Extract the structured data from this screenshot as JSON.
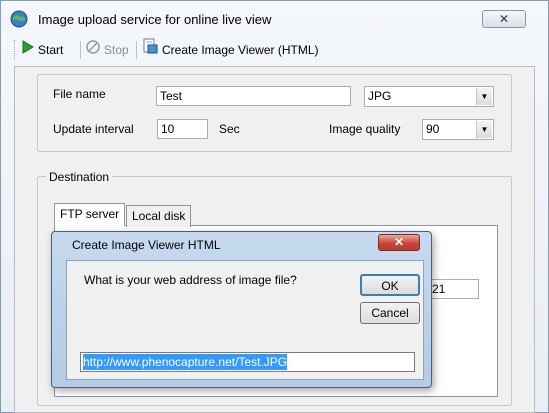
{
  "window": {
    "title": "Image upload service for online live view",
    "close_glyph": "✕"
  },
  "toolbar": {
    "start_label": "Start",
    "stop_label": "Stop",
    "create_viewer_label": "Create Image Viewer (HTML)"
  },
  "settings": {
    "file_name_label": "File name",
    "file_name_value": "Test",
    "format_value": "JPG",
    "update_interval_label": "Update interval",
    "update_interval_value": "10",
    "update_interval_unit": "Sec",
    "image_quality_label": "Image quality",
    "image_quality_value": "90"
  },
  "destination": {
    "legend": "Destination",
    "tabs": [
      {
        "label": "FTP server"
      },
      {
        "label": "Local disk"
      }
    ],
    "partial_field_value": "21"
  },
  "dialog": {
    "title": "Create Image Viewer HTML",
    "close_glyph": "✕",
    "prompt": "What is your web address of image file?",
    "ok_label": "OK",
    "cancel_label": "Cancel",
    "url_value": "http://www.phenocapture.net/Test.JPG"
  },
  "colors": {
    "accent": "#3399ff",
    "start_green": "#2e9e2e",
    "dialog_frame": "#b3cbe6"
  }
}
